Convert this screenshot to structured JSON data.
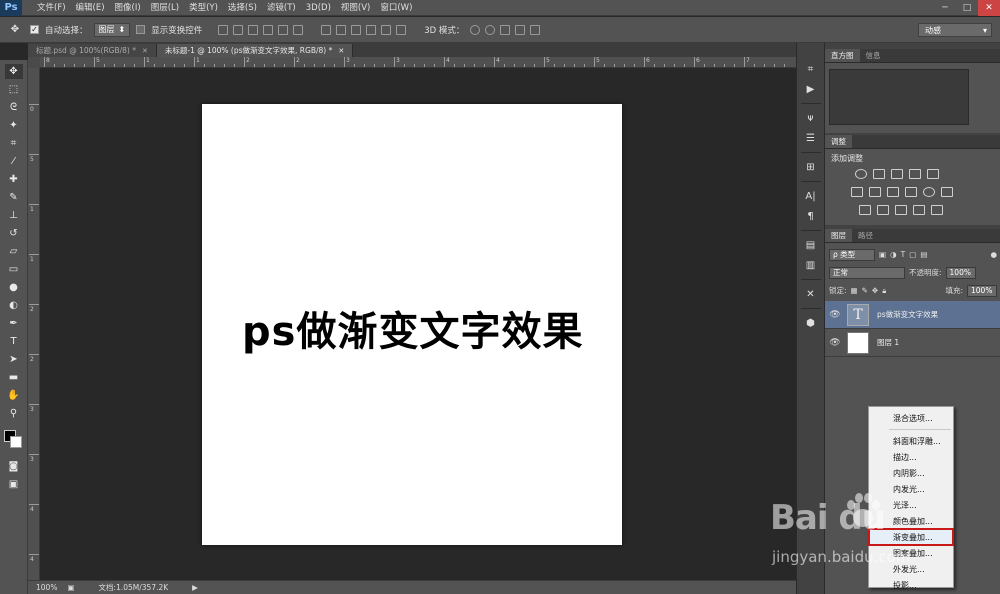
{
  "app": {
    "logo": "Ps",
    "menus": [
      "文件(F)",
      "编辑(E)",
      "图像(I)",
      "图层(L)",
      "类型(Y)",
      "选择(S)",
      "滤镜(T)",
      "3D(D)",
      "视图(V)",
      "窗口(W)"
    ],
    "window_controls": [
      "─",
      "□",
      "✕"
    ]
  },
  "options": {
    "auto_select_label": "自动选择：",
    "auto_select_value": "图层",
    "show_transform_label": "显示变换控件",
    "mode_3d_label": "3D 模式：",
    "workspace": "动感"
  },
  "tabs": [
    {
      "label": "标题.psd @ 100%(RGB/8) *",
      "active": false
    },
    {
      "label": "未标题-1 @ 100% (ps做渐变文字效果, RGB/8) *",
      "active": true
    }
  ],
  "rulers": {
    "h_labels": [
      "8",
      "5",
      "1",
      "1",
      "2",
      "2",
      "3",
      "3",
      "4",
      "4",
      "5",
      "5",
      "6",
      "6",
      "7",
      "7",
      "8"
    ],
    "v_labels": [
      "0",
      "5",
      "1",
      "1",
      "2",
      "2",
      "3",
      "3",
      "4",
      "4"
    ]
  },
  "canvas": {
    "text": "ps做渐变文字效果"
  },
  "status": {
    "zoom": "100%",
    "doc_info": "文档:1.05M/357.2K"
  },
  "panels": {
    "histogram_tabs": [
      "直方图",
      "信息"
    ],
    "adjust_tab": "调整",
    "adjust_title": "添加调整",
    "layers_tabs": [
      "图层",
      "路径"
    ],
    "kind_filter": "ρ 类型",
    "blend_mode": "正常",
    "opacity_label": "不透明度:",
    "opacity_value": "100%",
    "lock_label": "锁定:",
    "fill_label": "填充:",
    "fill_value": "100%",
    "layers": [
      {
        "name": "ps做渐变文字效果",
        "type": "text",
        "selected": true
      },
      {
        "name": "图层 1",
        "type": "pixel",
        "selected": false
      }
    ]
  },
  "context_menu": {
    "items": [
      "混合选项...",
      "斜面和浮雕...",
      "描边...",
      "内阴影...",
      "内发光...",
      "光泽...",
      "颜色叠加...",
      "渐变叠加...",
      "图案叠加...",
      "外发光...",
      "投影..."
    ],
    "highlighted_index": 7
  },
  "watermark": {
    "logo": "Bai du",
    "url": "jingyan.baidu.com"
  }
}
